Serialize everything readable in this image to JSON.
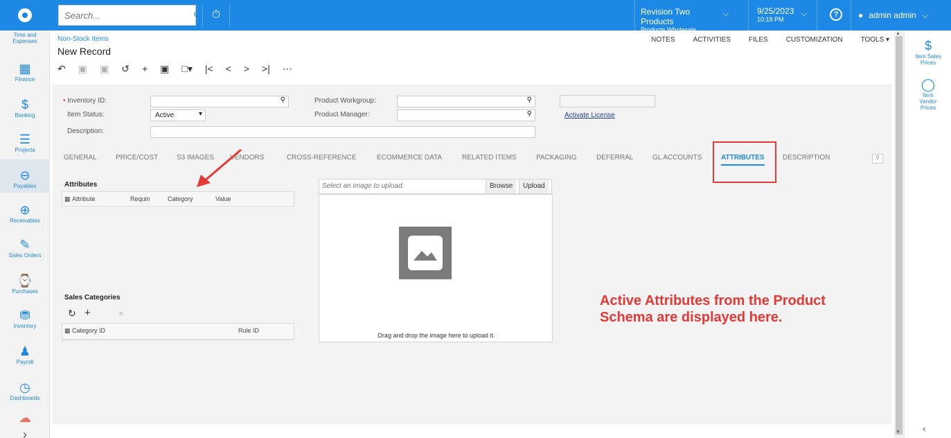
{
  "topbar": {
    "search_placeholder": "Search...",
    "company_name": "Revision Two Products",
    "company_sub": "Products Wholesale",
    "date": "9/25/2023",
    "time": "10:18 PM",
    "user": "admin admin"
  },
  "leftnav": {
    "items": [
      {
        "label": "Time and Expenses",
        "icon": "clock-icon"
      },
      {
        "label": "Finance",
        "icon": "calculator-icon"
      },
      {
        "label": "Banking",
        "icon": "dollar-icon"
      },
      {
        "label": "Projects",
        "icon": "projects-icon"
      },
      {
        "label": "Payables",
        "icon": "minus-circle-icon"
      },
      {
        "label": "Receivables",
        "icon": "plus-circle-icon"
      },
      {
        "label": "Sales Orders",
        "icon": "edit-icon"
      },
      {
        "label": "Purchases",
        "icon": "cart-icon"
      },
      {
        "label": "Inventory",
        "icon": "truck-icon"
      },
      {
        "label": "Payroll",
        "icon": "payroll-icon"
      },
      {
        "label": "Dashboards",
        "icon": "gauge-icon"
      }
    ]
  },
  "header": {
    "breadcrumb": "Non-Stock Items",
    "title": "New Record",
    "links": [
      "NOTES",
      "ACTIVITIES",
      "FILES",
      "CUSTOMIZATION",
      "TOOLS ▾"
    ]
  },
  "form": {
    "inventory_id_label": "Inventory ID:",
    "item_status_label": "Item Status:",
    "item_status_value": "Active",
    "description_label": "Description:",
    "product_workgroup_label": "Product Workgroup:",
    "product_manager_label": "Product Manager:",
    "activate_license": "Activate License"
  },
  "tabs": [
    "GENERAL",
    "PRICE/COST",
    "S3 IMAGES",
    "VENDORS",
    "CROSS-REFERENCE",
    "ECOMMERCE DATA",
    "RELATED ITEMS",
    "PACKAGING",
    "DEFERRAL",
    "GL ACCOUNTS",
    "ATTRIBUTES",
    "DESCRIPTION"
  ],
  "active_tab": "ATTRIBUTES",
  "attributes": {
    "title": "Attributes",
    "columns": [
      "Attribute",
      "Requin",
      "Category",
      "Value"
    ]
  },
  "sales_categories": {
    "title": "Sales Categories",
    "columns": [
      "Category ID",
      "Rule ID"
    ]
  },
  "upload": {
    "placeholder": "Select an image to upload.",
    "browse": "Browse",
    "upload": "Upload",
    "drop_text": "Drag and drop the image here to upload it."
  },
  "rightpanel": {
    "items": [
      {
        "label": "Item Sales Prices",
        "icon": "dollar-icon"
      },
      {
        "label": "Item Vendor Prices",
        "icon": "tag-icon"
      }
    ]
  },
  "annotation": {
    "line1": "Active Attributes from the Product",
    "line2": "Schema are displayed here.",
    "color": "#e53935"
  }
}
